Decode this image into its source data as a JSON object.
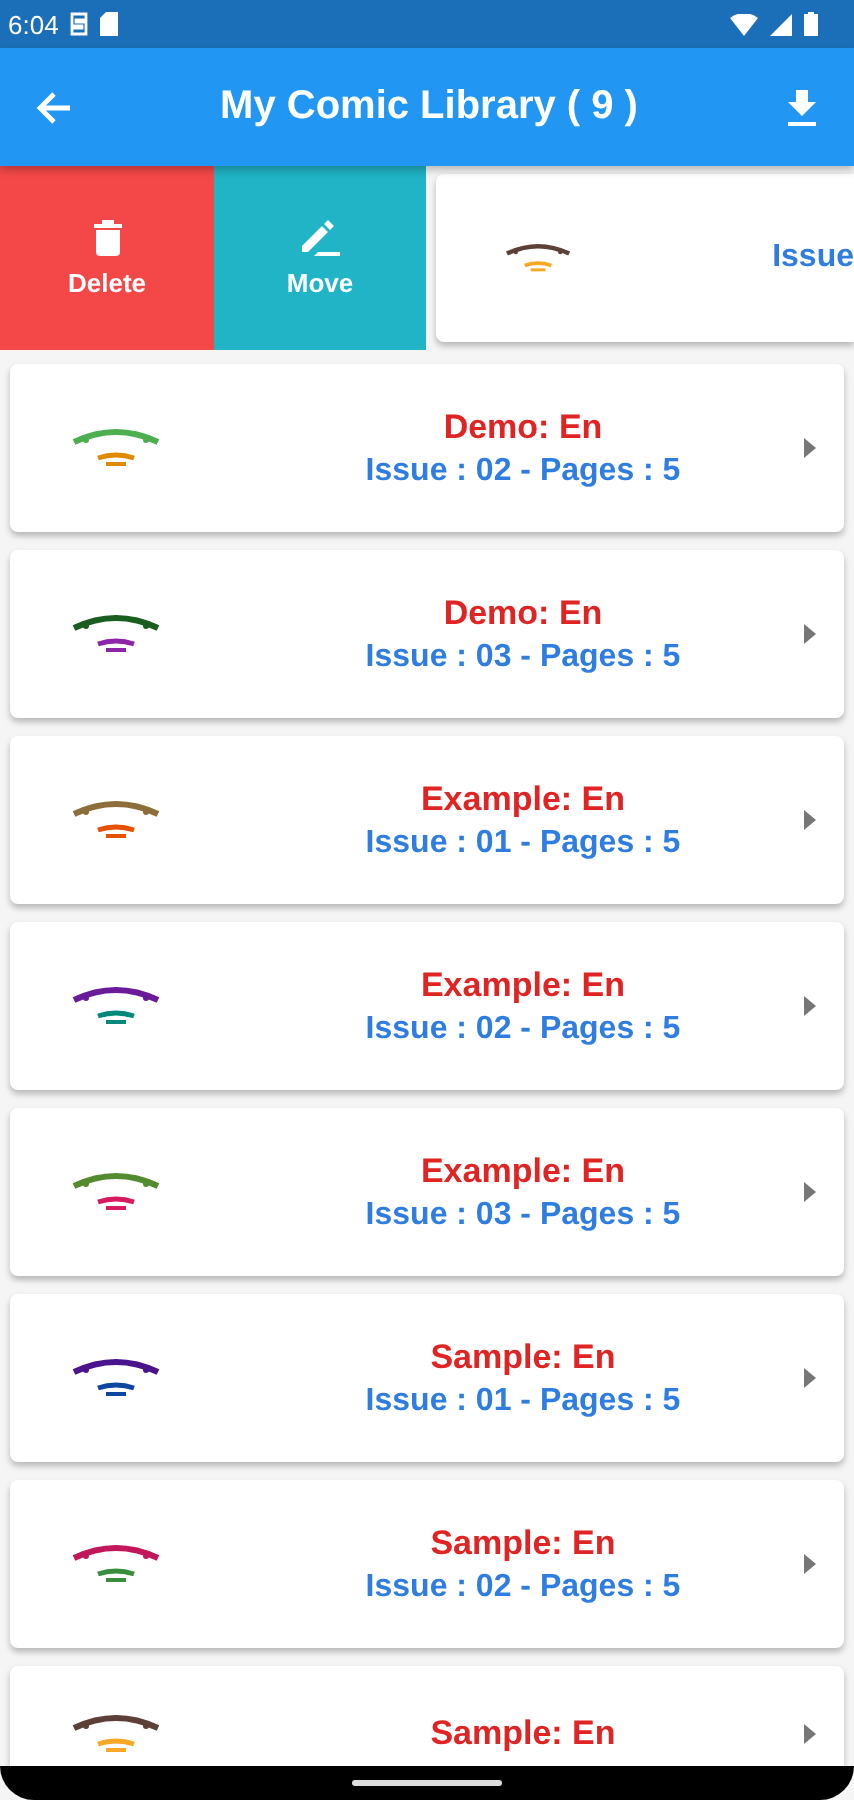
{
  "status_bar": {
    "time": "6:04"
  },
  "app_bar": {
    "title": "My Comic Library ( 9 )"
  },
  "swipe_actions": [
    {
      "kind": "delete",
      "label": "Delete"
    },
    {
      "kind": "move",
      "label": "Move"
    }
  ],
  "swiped_item": {
    "subtitle": "Issue"
  },
  "comics": [
    {
      "title": "Demo: En",
      "subtitle": "Issue : 02 - Pages : 5"
    },
    {
      "title": "Demo: En",
      "subtitle": "Issue : 03 - Pages : 5"
    },
    {
      "title": "Example: En",
      "subtitle": "Issue : 01 - Pages : 5"
    },
    {
      "title": "Example: En",
      "subtitle": "Issue : 02 - Pages : 5"
    },
    {
      "title": "Example: En",
      "subtitle": "Issue : 03 - Pages : 5"
    },
    {
      "title": "Sample: En",
      "subtitle": "Issue : 01 - Pages : 5"
    },
    {
      "title": "Sample: En",
      "subtitle": "Issue : 02 - Pages : 5"
    },
    {
      "title": "Sample: En"
    }
  ]
}
